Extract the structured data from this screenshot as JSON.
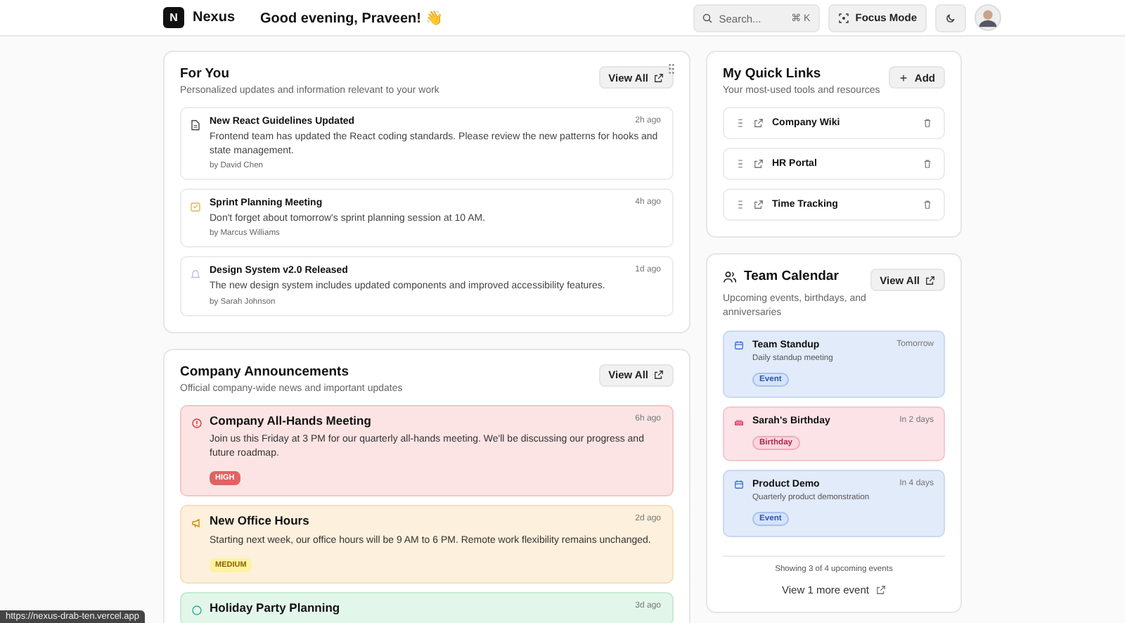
{
  "header": {
    "logo": "N",
    "brand": "Nexus",
    "greeting": "Good evening, Praveen! 👋",
    "search": {
      "placeholder": "Search...",
      "shortcut": "⌘ K"
    },
    "focus_button": "Focus Mode"
  },
  "for_you": {
    "title": "For You",
    "subtitle": "Personalized updates and information relevant to your work",
    "view_all": "View All",
    "items": [
      {
        "kind": "document",
        "title": "New React Guidelines Updated",
        "time": "2h ago",
        "body": "Frontend team has updated the React coding standards. Please review the new patterns for hooks and state management.",
        "author": "by David Chen"
      },
      {
        "kind": "task",
        "title": "Sprint Planning Meeting",
        "time": "4h ago",
        "body": "Don't forget about tomorrow's sprint planning session at 10 AM.",
        "author": "by Marcus Williams"
      },
      {
        "kind": "notification",
        "title": "Design System v2.0 Released",
        "time": "1d ago",
        "body": "The new design system includes updated components and improved accessibility features.",
        "author": "by Sarah Johnson"
      }
    ]
  },
  "announcements": {
    "title": "Company Announcements",
    "subtitle": "Official company-wide news and important updates",
    "view_all": "View All",
    "items": [
      {
        "kind": "high",
        "title": "Company All-Hands Meeting",
        "time": "6h ago",
        "body": "Join us this Friday at 3 PM for our quarterly all-hands meeting. We'll be discussing our progress and future roadmap.",
        "priority": "HIGH"
      },
      {
        "kind": "medium",
        "title": "New Office Hours",
        "time": "2d ago",
        "body": "Starting next week, our office hours will be 9 AM to 6 PM. Remote work flexibility remains unchanged.",
        "priority": "MEDIUM"
      },
      {
        "kind": "low",
        "title": "Holiday Party Planning",
        "time": "3d ago"
      }
    ]
  },
  "quick_links": {
    "title": "My Quick Links",
    "subtitle": "Your most-used tools and resources",
    "add": "Add",
    "items": [
      {
        "label": "Company Wiki"
      },
      {
        "label": "HR Portal"
      },
      {
        "label": "Time Tracking"
      }
    ]
  },
  "calendar": {
    "title": "Team Calendar",
    "subtitle": "Upcoming events, birthdays, and anniversaries",
    "view_all": "View All",
    "events": [
      {
        "kind": "event",
        "title": "Team Standup",
        "when": "Tomorrow",
        "detail": "Daily standup meeting",
        "tag": "Event"
      },
      {
        "kind": "birthday",
        "title": "Sarah's Birthday",
        "when": "In 2 days",
        "tag": "Birthday"
      },
      {
        "kind": "event",
        "title": "Product Demo",
        "when": "In 4 days",
        "detail": "Quarterly product demonstration",
        "tag": "Event"
      }
    ],
    "summary": "Showing 3 of 4 upcoming events",
    "more": "View 1 more event"
  },
  "status_url": "https://nexus-drab-ten.vercel.app"
}
